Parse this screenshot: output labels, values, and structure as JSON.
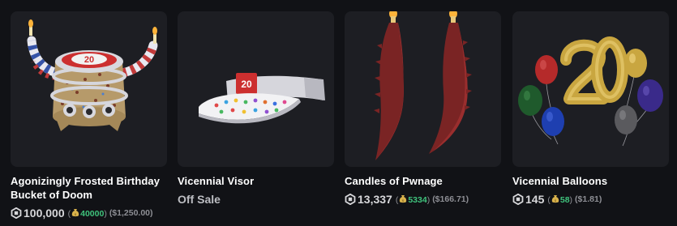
{
  "items": [
    {
      "name": "Agonizingly Frosted Birthday Bucket of Doom",
      "price": "100,000",
      "alt_price": "40000",
      "usd": "($1,250.00)",
      "status": ""
    },
    {
      "name": "Vicennial Visor",
      "price": "",
      "alt_price": "",
      "usd": "",
      "status": "Off Sale"
    },
    {
      "name": "Candles of Pwnage",
      "price": "13,337",
      "alt_price": "5334",
      "usd": "($166.71)",
      "status": ""
    },
    {
      "name": "Vicennial Balloons",
      "price": "145",
      "alt_price": "58",
      "usd": "($1.81)",
      "status": ""
    }
  ],
  "thumbnail_labels": {
    "bucket": "20",
    "visor": "20"
  },
  "icons": {
    "currency": "robux-icon",
    "alt_currency": "money-bag-icon"
  },
  "colors": {
    "background": "#111216",
    "card": "#1d1e23",
    "alt_price": "#3fc27c",
    "muted": "#8e8f95"
  }
}
